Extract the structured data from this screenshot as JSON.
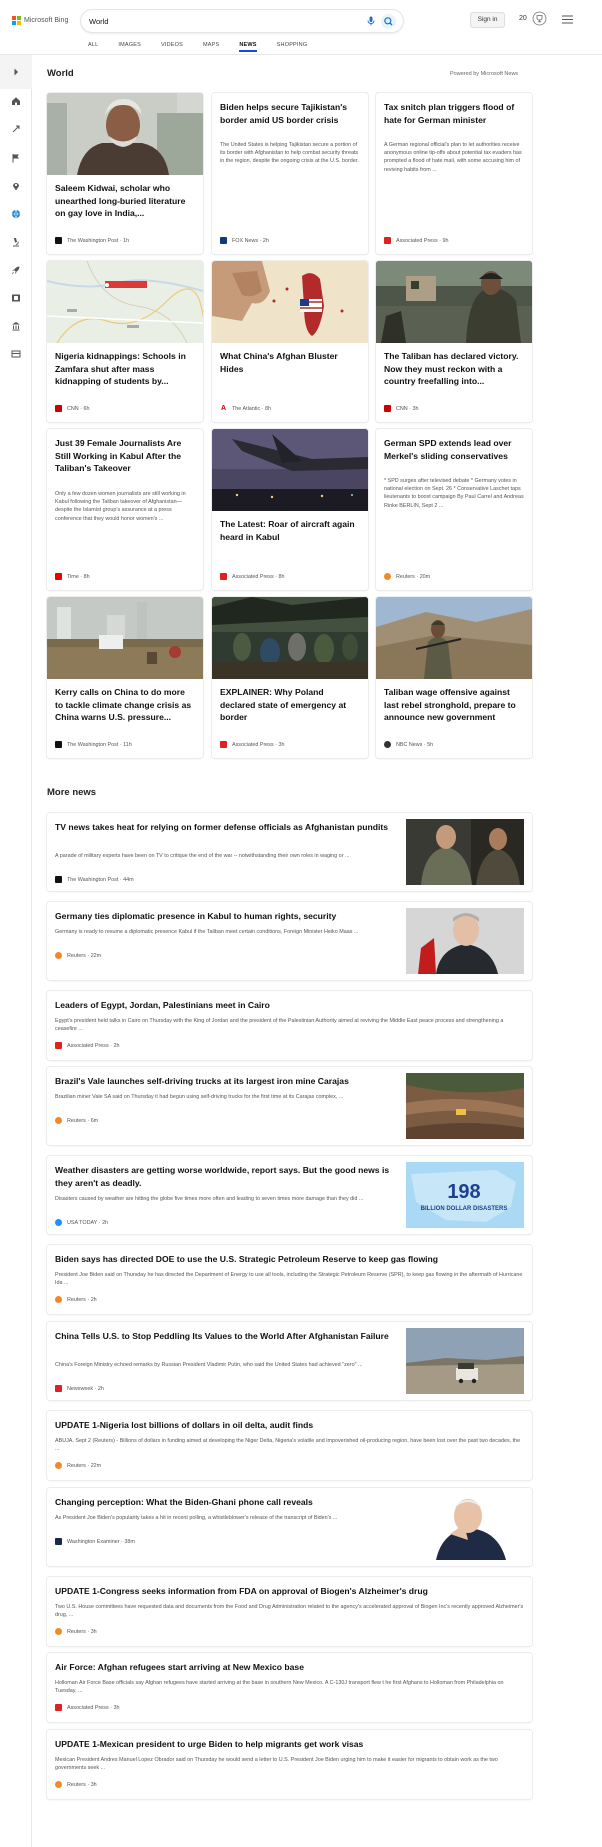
{
  "header": {
    "brand": "Microsoft Bing",
    "search_value": "World",
    "signin_label": "Sign in",
    "reward_points": "20",
    "tabs": [
      "ALL",
      "IMAGES",
      "VIDEOS",
      "MAPS",
      "NEWS",
      "SHOPPING"
    ],
    "active_tab": "NEWS"
  },
  "colors": {
    "accent": "#174ae4",
    "ms_red": "#f35325",
    "ms_green": "#81bc06",
    "ms_blue": "#05a6f0",
    "ms_yellow": "#ffba08"
  },
  "sidebar": {
    "icons": [
      "expand-icon",
      "home-icon",
      "fire-icon",
      "flag-icon",
      "location-pin-icon",
      "globe-icon",
      "microscope-icon",
      "rocket-icon",
      "film-icon",
      "bank-icon",
      "chart-icon"
    ]
  },
  "world": {
    "title": "World",
    "powered": "Powered by Microsoft News",
    "cards": [
      {
        "title": "Saleem Kidwai, scholar who unearthed long-buried literature on gay love in India,...",
        "desc": "",
        "source": "The Washington Post",
        "time": "1h"
      },
      {
        "title": "Biden helps secure Tajikistan's border amid US border crisis",
        "desc": "The United States is helping Tajikistan secure a portion of its border with Afghanistan to help combat security threats in the region, despite the ongoing crisis at the U.S. border.",
        "source": "FOX News",
        "time": "2h"
      },
      {
        "title": "Tax snitch plan triggers flood of hate for German minister",
        "desc": "A German regional official's plan to let authorities receive anonymous online tip-offs about potential tax evaders has prompted a flood of hate mail, with some accusing him of reviving habits from ...",
        "source": "Associated Press",
        "time": "9h"
      },
      {
        "title": "Nigeria kidnappings: Schools in Zamfara shut after mass kidnapping of students by...",
        "desc": "",
        "source": "CNN",
        "time": "6h"
      },
      {
        "title": "What China's Afghan Bluster Hides",
        "desc": "",
        "source": "The Atlantic",
        "time": "8h"
      },
      {
        "title": "The Taliban has declared victory. Now they must reckon with a country freefalling into...",
        "desc": "",
        "source": "CNN",
        "time": "3h"
      },
      {
        "title": "Just 39 Female Journalists Are Still Working in Kabul After the Taliban's Takeover",
        "desc": "Only a few dozen women journalists are still working in Kabul following the Taliban takeover of Afghanistan—despite the Islamist group's assurance at a press conference that they would honor women's ...",
        "source": "Time",
        "time": "8h"
      },
      {
        "title": "The Latest: Roar of aircraft again heard in Kabul",
        "desc": "",
        "source": "Associated Press",
        "time": "8h"
      },
      {
        "title": "German SPD extends lead over Merkel's sliding conservatives",
        "desc": "* SPD surges after televised debate * Germany votes in national election on Sept. 26 * Conservative Laschet taps lieutenants to boost campaign By Paul Carrel and Andreas Rinke BERLIN, Sept 2 ...",
        "source": "Reuters",
        "time": "20m"
      },
      {
        "title": "Kerry calls on China to do more to tackle climate change crisis as China warns U.S. pressure...",
        "desc": "",
        "source": "The Washington Post",
        "time": "11h"
      },
      {
        "title": "EXPLAINER: Why Poland declared state of emergency at border",
        "desc": "",
        "source": "Associated Press",
        "time": "3h"
      },
      {
        "title": "Taliban wage offensive against last rebel stronghold, prepare to announce new government",
        "desc": "",
        "source": "NBC News",
        "time": "5h"
      }
    ]
  },
  "more": {
    "title": "More news",
    "items": [
      {
        "title": "TV news takes heat for relying on former defense officials as Afghanistan pundits",
        "desc": "A parade of military experts have been on TV to critique the end of the war -- notwithstanding their own roles in waging or ...",
        "source": "The Washington Post",
        "time": "44m"
      },
      {
        "title": "Germany ties diplomatic presence in Kabul to human rights, security",
        "desc": "Germany is ready to resume a diplomatic presence Kabul if the Taliban meet certain conditions, Foreign Minister Heiko Maas ...",
        "source": "Reuters",
        "time": "22m"
      },
      {
        "title": "Leaders of Egypt, Jordan, Palestinians meet in Cairo",
        "desc": "Egypt's president held talks in Cairo on Thursday with the King of Jordan and the president of the Palestinian Authority aimed at reviving the Middle East peace process and strengthening a ceasefire ...",
        "source": "Associated Press",
        "time": "2h"
      },
      {
        "title": "Brazil's Vale launches self-driving trucks at its largest iron mine Carajas",
        "desc": "Brazilian miner Vale SA said on Thursday it had begun using self-driving trucks for the first time at its Carajas complex, ...",
        "source": "Reuters",
        "time": "6m"
      },
      {
        "title": "Weather disasters are getting worse worldwide, report says. But the good news is they aren't as deadly.",
        "desc": "Disasters caused by weather are hitting the globe five times more often and leading to seven times more damage than they did ...",
        "source": "USA TODAY",
        "time": "2h",
        "img_number": "198",
        "img_caption": "BILLION DOLLAR DISASTERS"
      },
      {
        "title": "Biden says has directed DOE to use the U.S. Strategic Petroleum Reserve to keep gas flowing",
        "desc": "President Joe Biden said on Thursday he has directed the Department of Energy to use all tools, including the Strategic Petroleum Reserve (SPR), to keep gas flowing in the aftermath of Hurricane Ida ...",
        "source": "Reuters",
        "time": "2h"
      },
      {
        "title": "China Tells U.S. to Stop Peddling Its Values to the World After Afghanistan Failure",
        "desc": "China's Foreign Ministry echoed remarks by Russian President Vladimir Putin, who said the United States had achieved \"zero\" ...",
        "source": "Newsweek",
        "time": "2h"
      },
      {
        "title": "UPDATE 1-Nigeria lost billions of dollars in oil delta, audit finds",
        "desc": "ABUJA, Sept 2 (Reuters) - Billions of dollars in funding aimed at developing the Niger Delta, Nigeria's volatile and impoverished oil-producing region, have been lost over the past two decades, the ...",
        "source": "Reuters",
        "time": "22m"
      },
      {
        "title": "Changing perception: What the Biden-Ghani phone call reveals",
        "desc": "As President Joe Biden's popularity takes a hit in recent polling, a whistleblower's release of the transcript of Biden's ...",
        "source": "Washington Examiner",
        "time": "38m"
      },
      {
        "title": "UPDATE 1-Congress seeks information from FDA on approval of Biogen's Alzheimer's drug",
        "desc": "Two U.S. House committees have requested data and documents from the Food and Drug Administration related to the agency's accelerated approval of Biogen Inc's recently approved Alzheimer's drug, ...",
        "source": "Reuters",
        "time": "3h"
      },
      {
        "title": "Air Force: Afghan refugees start arriving at New Mexico base",
        "desc": "Holloman Air Force Base officials say Afghan refugees have started arriving at the base in southern New Mexico. A C-130J transport flew t he first Afghans to Holloman from Philadelphia on Tuesday, ...",
        "source": "Associated Press",
        "time": "3h"
      },
      {
        "title": "UPDATE 1-Mexican president to urge Biden to help migrants get work visas",
        "desc": "Mexican President Andres Manuel Lopez Obrador said on Thursday he would send a letter to U.S. President Joe Biden urging him to make it easier for migrants to obtain work as the two governments seek ...",
        "source": "Reuters",
        "time": "3h"
      }
    ]
  }
}
